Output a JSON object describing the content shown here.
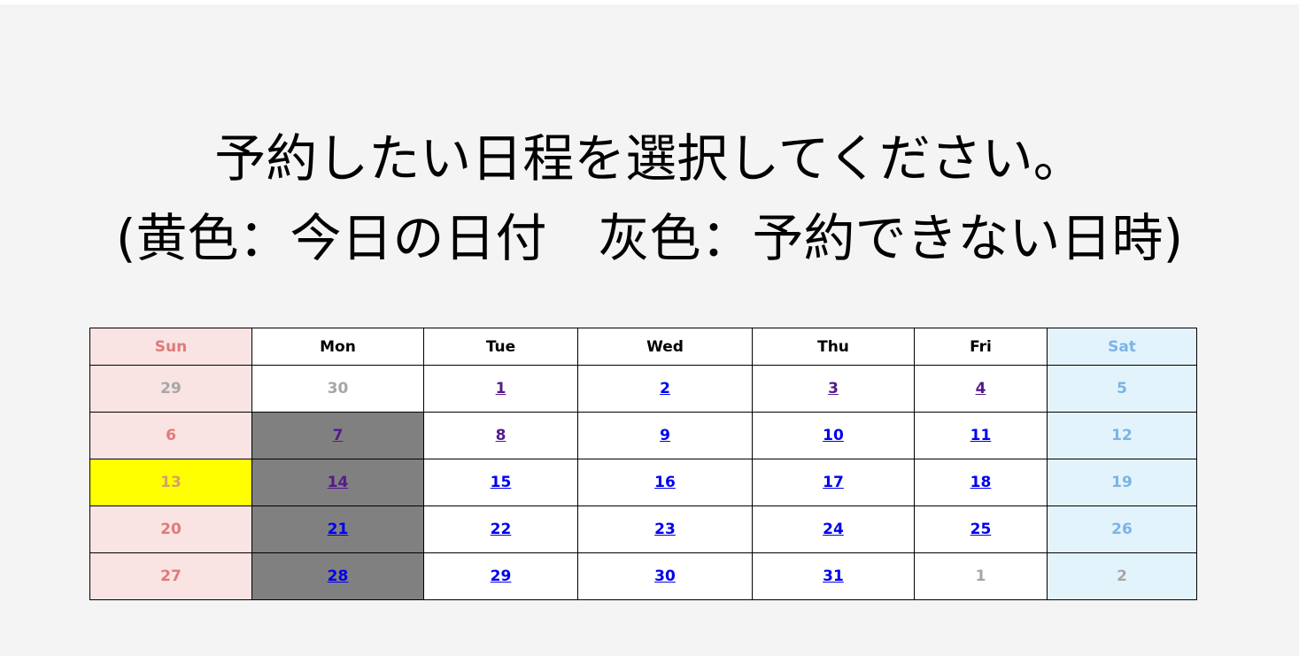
{
  "title": {
    "line1": "予約したい日程を選択してください。",
    "line2": "(黄色：今日の日付　灰色：予約できない日時)"
  },
  "colors": {
    "page_background": "#f4f4f4",
    "sunday_background": "#f9e3e3",
    "saturday_background": "#e3f3fc",
    "sunday_text": "#e07a7a",
    "saturday_text": "#7ab4e6",
    "today": "#ffff00",
    "unavailable": "#808080",
    "link": "#0000ee",
    "visited_link": "#551a8b",
    "other_month_text": "#a6a6a6"
  },
  "calendar": {
    "weekdays": [
      "Sun",
      "Mon",
      "Tue",
      "Wed",
      "Thu",
      "Fri",
      "Sat"
    ],
    "weeks": [
      [
        {
          "day": "29",
          "type": "other"
        },
        {
          "day": "30",
          "type": "other"
        },
        {
          "day": "1",
          "type": "link",
          "visited": true
        },
        {
          "day": "2",
          "type": "link",
          "visited": false
        },
        {
          "day": "3",
          "type": "link",
          "visited": true
        },
        {
          "day": "4",
          "type": "link",
          "visited": true
        },
        {
          "day": "5",
          "type": "weekend"
        }
      ],
      [
        {
          "day": "6",
          "type": "weekend"
        },
        {
          "day": "7",
          "type": "link",
          "visited": true,
          "unavailable": true
        },
        {
          "day": "8",
          "type": "link",
          "visited": true
        },
        {
          "day": "9",
          "type": "link",
          "visited": false
        },
        {
          "day": "10",
          "type": "link",
          "visited": false
        },
        {
          "day": "11",
          "type": "link",
          "visited": false
        },
        {
          "day": "12",
          "type": "weekend"
        }
      ],
      [
        {
          "day": "13",
          "type": "weekend",
          "today": true
        },
        {
          "day": "14",
          "type": "link",
          "visited": true,
          "unavailable": true
        },
        {
          "day": "15",
          "type": "link",
          "visited": false
        },
        {
          "day": "16",
          "type": "link",
          "visited": false
        },
        {
          "day": "17",
          "type": "link",
          "visited": false
        },
        {
          "day": "18",
          "type": "link",
          "visited": false
        },
        {
          "day": "19",
          "type": "weekend"
        }
      ],
      [
        {
          "day": "20",
          "type": "weekend"
        },
        {
          "day": "21",
          "type": "link",
          "visited": false,
          "unavailable": true
        },
        {
          "day": "22",
          "type": "link",
          "visited": false
        },
        {
          "day": "23",
          "type": "link",
          "visited": false
        },
        {
          "day": "24",
          "type": "link",
          "visited": false
        },
        {
          "day": "25",
          "type": "link",
          "visited": false
        },
        {
          "day": "26",
          "type": "weekend"
        }
      ],
      [
        {
          "day": "27",
          "type": "weekend"
        },
        {
          "day": "28",
          "type": "link",
          "visited": false,
          "unavailable": true
        },
        {
          "day": "29",
          "type": "link",
          "visited": false
        },
        {
          "day": "30",
          "type": "link",
          "visited": false
        },
        {
          "day": "31",
          "type": "link",
          "visited": false
        },
        {
          "day": "1",
          "type": "other"
        },
        {
          "day": "2",
          "type": "other"
        }
      ]
    ]
  }
}
